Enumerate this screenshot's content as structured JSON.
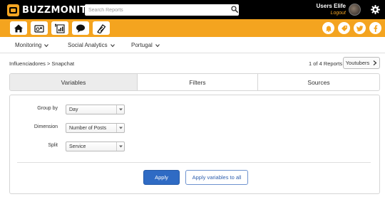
{
  "app": {
    "logo_text": "BUZZMONITOR",
    "search_placeholder": "Search Reports",
    "user_name": "Users Elife",
    "logout_label": "Logout"
  },
  "toolbar": {
    "nav_icons": [
      "home-icon",
      "monitoring-icon",
      "reports-icon",
      "chat-icon",
      "feed-icon"
    ],
    "social_icons": [
      "notification-icon",
      "tag-icon",
      "twitter-icon",
      "facebook-icon"
    ],
    "accent_color": "#f4a41f"
  },
  "menu": {
    "items": [
      {
        "label": "Monitoring"
      },
      {
        "label": "Social Analytics"
      },
      {
        "label": "Portugal"
      }
    ]
  },
  "breadcrumb": "Influenciadores > Snapchat",
  "pager": {
    "text": "1 of 4 Reports",
    "button_label": "Youtubers"
  },
  "tabs": [
    {
      "label": "Variables",
      "active": true
    },
    {
      "label": "Filters",
      "active": false
    },
    {
      "label": "Sources",
      "active": false
    }
  ],
  "form": {
    "group_by": {
      "label": "Group by",
      "value": "Day"
    },
    "dimension": {
      "label": "Dimension",
      "value": "Number of Posts"
    },
    "split": {
      "label": "Split",
      "value": "Service"
    }
  },
  "actions": {
    "apply_label": "Apply",
    "apply_all_label": "Apply variables to all",
    "primary_color": "#2f6bc4"
  }
}
